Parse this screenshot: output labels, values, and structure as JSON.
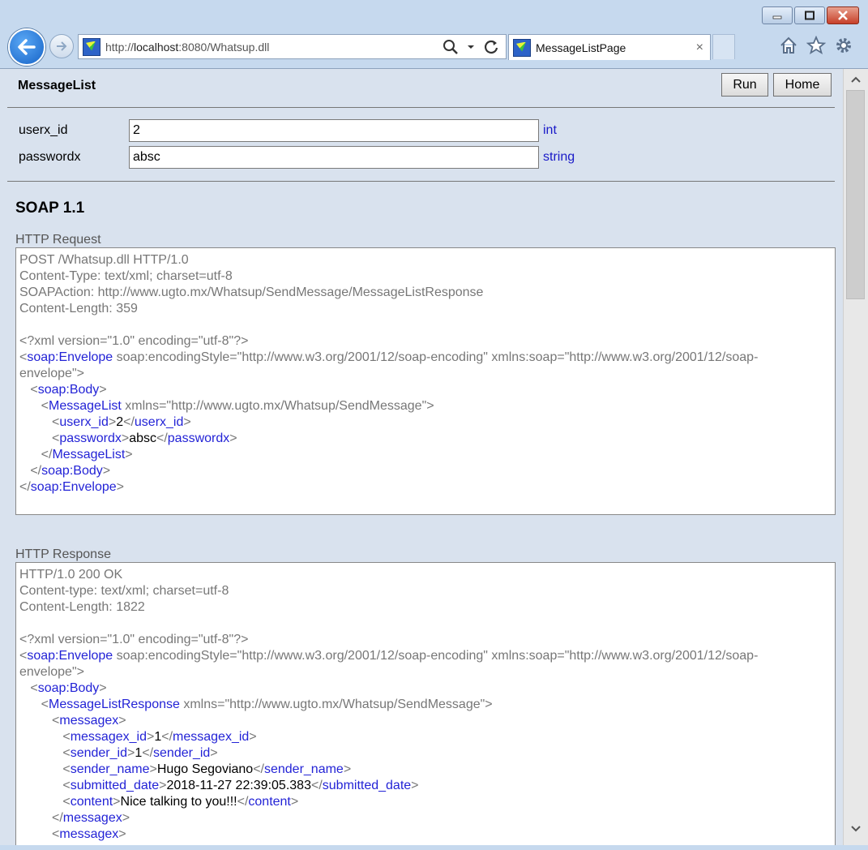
{
  "browser": {
    "url_prefix": "http://",
    "url_host": "localhost",
    "url_rest": ":8080/Whatsup.dll",
    "tab_title": "MessageListPage",
    "tab_close": "×"
  },
  "page": {
    "title": "MessageList",
    "run_label": "Run",
    "home_label": "Home",
    "params": [
      {
        "label": "userx_id",
        "value": "2",
        "type": "int"
      },
      {
        "label": "passwordx",
        "value": "absc",
        "type": "string"
      }
    ],
    "soap_title": "SOAP 1.1",
    "request_label": "HTTP Request",
    "response_label": "HTTP Response",
    "request": {
      "line1": "POST /Whatsup.dll HTTP/1.0",
      "line2": "Content-Type: text/xml; charset=utf-8",
      "line3": "SOAPAction: http://www.ugto.mx/Whatsup/SendMessage/MessageListResponse",
      "line4": "Content-Length: 359",
      "xml_decl": "<?xml version=\"1.0\" encoding=\"utf-8\"?>",
      "envelope_attr1": " soap:encodingStyle=\"http://www.w3.org/2001/12/soap-encoding\" xmlns:soap=\"http://www.w3.org/2001/12/soap-",
      "envelope_attr2": "envelope\">",
      "ml_attr": " xmlns=\"http://www.ugto.mx/Whatsup/SendMessage\">",
      "userx_val": "2",
      "passwordx_val": "absc"
    },
    "response": {
      "line1": "HTTP/1.0 200 OK",
      "line2": "Content-type: text/xml; charset=utf-8",
      "line3": "Content-Length: 1822",
      "xml_decl": "<?xml version=\"1.0\" encoding=\"utf-8\"?>",
      "envelope_attr1": " soap:encodingStyle=\"http://www.w3.org/2001/12/soap-encoding\" xmlns:soap=\"http://www.w3.org/2001/12/soap-",
      "envelope_attr2": "envelope\">",
      "mlr_attr": " xmlns=\"http://www.ugto.mx/Whatsup/SendMessage\">",
      "messagex_id": "1",
      "sender_id": "1",
      "sender_name": "Hugo Segoviano",
      "submitted_date": "2018-11-27 22:39:05.383",
      "content": "Nice talking to you!!!"
    },
    "tags": {
      "envelope": "soap:Envelope",
      "body": "soap:Body",
      "message_list": "MessageList",
      "message_list_response": "MessageListResponse",
      "userx_id": "userx_id",
      "passwordx": "passwordx",
      "messagex": "messagex",
      "messagex_id": "messagex_id",
      "sender_id": "sender_id",
      "sender_name": "sender_name",
      "submitted_date": "submitted_date",
      "content": "content"
    }
  },
  "icons": {
    "back": "back-arrow-icon",
    "forward": "forward-arrow-icon",
    "search": "search-icon",
    "refresh": "refresh-icon",
    "home": "home-icon",
    "favorites": "star-icon",
    "settings": "gear-icon"
  }
}
